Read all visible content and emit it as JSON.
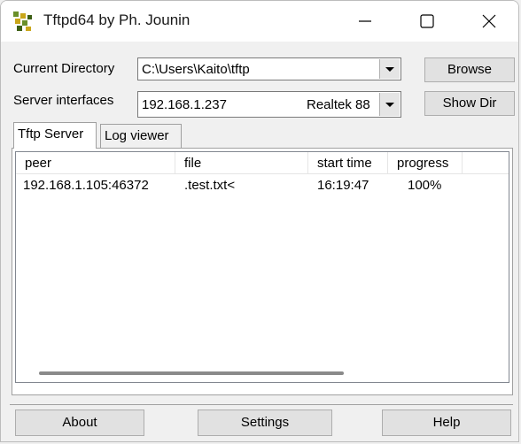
{
  "window": {
    "title": "Tftpd64 by Ph. Jounin",
    "icon": "tftpd-app-icon",
    "caption_buttons": [
      "minimize-icon",
      "maximize-icon",
      "close-icon"
    ]
  },
  "current_directory": {
    "label": "Current Directory",
    "value": "C:\\Users\\Kaito\\tftp"
  },
  "server_interfaces": {
    "label": "Server interfaces",
    "ip": "192.168.1.237",
    "adapter": "Realtek 88"
  },
  "buttons": {
    "browse": "Browse",
    "show_dir": "Show Dir",
    "about": "About",
    "settings": "Settings",
    "help": "Help"
  },
  "tabs": [
    {
      "label": "Tftp Server",
      "active": true
    },
    {
      "label": "Log viewer",
      "active": false
    }
  ],
  "transfers": {
    "columns": [
      "peer",
      "file",
      "start time",
      "progress"
    ],
    "rows": [
      {
        "peer": "192.168.1.105:46372",
        "file": ".test.txt<",
        "start_time": "16:19:47",
        "progress": "100%"
      }
    ]
  }
}
